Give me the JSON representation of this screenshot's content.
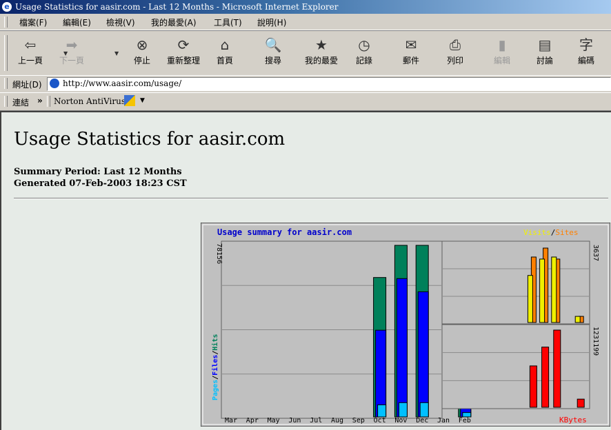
{
  "window": {
    "title": "Usage Statistics for aasir.com - Last 12 Months - Microsoft Internet Explorer"
  },
  "menu": [
    "檔案(F)",
    "編輯(E)",
    "檢視(V)",
    "我的最愛(A)",
    "工具(T)",
    "說明(H)"
  ],
  "toolbar": [
    {
      "label": "上一頁",
      "icon": "back-arrow-icon",
      "glyph": "⇦",
      "disabled": false
    },
    {
      "label": "下一頁",
      "icon": "forward-arrow-icon",
      "glyph": "➡",
      "disabled": true
    },
    {
      "label": "停止",
      "icon": "stop-icon",
      "glyph": "⊗",
      "disabled": false
    },
    {
      "label": "重新整理",
      "icon": "refresh-icon",
      "glyph": "⟳",
      "disabled": false
    },
    {
      "label": "首頁",
      "icon": "home-icon",
      "glyph": "⌂",
      "disabled": false
    },
    {
      "label": "搜尋",
      "icon": "search-icon",
      "glyph": "🔍",
      "disabled": false
    },
    {
      "label": "我的最愛",
      "icon": "favorites-icon",
      "glyph": "★",
      "disabled": false
    },
    {
      "label": "記錄",
      "icon": "history-icon",
      "glyph": "◷",
      "disabled": false
    },
    {
      "label": "郵件",
      "icon": "mail-icon",
      "glyph": "✉",
      "disabled": false
    },
    {
      "label": "列印",
      "icon": "print-icon",
      "glyph": "⎙",
      "disabled": false
    },
    {
      "label": "編輯",
      "icon": "edit-icon",
      "glyph": "▮",
      "disabled": true
    },
    {
      "label": "討論",
      "icon": "discuss-icon",
      "glyph": "▤",
      "disabled": false
    },
    {
      "label": "編碼",
      "icon": "encoding-icon",
      "glyph": "字",
      "disabled": false
    }
  ],
  "address": {
    "label": "網址(D)",
    "value": "http://www.aasir.com/usage/"
  },
  "links": {
    "label": "連結",
    "chevron": "»",
    "item": "Norton AntiVirus"
  },
  "page": {
    "title": "Usage Statistics for aasir.com",
    "period": "Summary Period: Last 12 Months",
    "generated": "Generated 07-Feb-2003 18:23 CST"
  },
  "chart_data": {
    "type": "bar",
    "title": "Usage summary for aasir.com",
    "categories": [
      "Mar",
      "Apr",
      "May",
      "Jun",
      "Jul",
      "Aug",
      "Sep",
      "Oct",
      "Nov",
      "Dec",
      "Jan",
      "Feb"
    ],
    "main": {
      "ymax": 78156,
      "ymax_label": "78156",
      "axis_labels": [
        "Pages",
        "/",
        "Files",
        "/",
        "Hits"
      ],
      "series": [
        {
          "name": "Hits",
          "color": "#00805a",
          "values": [
            0,
            0,
            0,
            0,
            0,
            0,
            0,
            63500,
            78156,
            78156,
            0,
            8500
          ]
        },
        {
          "name": "Files",
          "color": "#0000ff",
          "values": [
            0,
            0,
            0,
            0,
            0,
            0,
            0,
            39500,
            63000,
            57000,
            0,
            4000
          ]
        },
        {
          "name": "Pages",
          "color": "#00c0ff",
          "values": [
            0,
            0,
            0,
            0,
            0,
            0,
            0,
            5500,
            6500,
            6500,
            0,
            2000
          ]
        }
      ]
    },
    "visits_sites": {
      "legend": [
        "Visits",
        "/",
        "Sites"
      ],
      "ymax": 3637,
      "ymax_label": "3637",
      "series": [
        {
          "name": "Visits",
          "color": "#f0f000",
          "values": [
            0,
            0,
            0,
            0,
            0,
            0,
            0,
            2300,
            3100,
            3200,
            0,
            300
          ]
        },
        {
          "name": "Sites",
          "color": "#ff8000",
          "values": [
            0,
            0,
            0,
            0,
            0,
            0,
            0,
            3200,
            3637,
            3100,
            0,
            300
          ]
        }
      ]
    },
    "kbytes": {
      "label": "KBytes",
      "ymax": 1231199,
      "ymax_label": "1231199",
      "series": [
        {
          "name": "KBytes",
          "color": "#ff0000",
          "values": [
            0,
            0,
            0,
            0,
            0,
            0,
            0,
            660000,
            960000,
            1231199,
            0,
            130000
          ]
        }
      ]
    }
  }
}
